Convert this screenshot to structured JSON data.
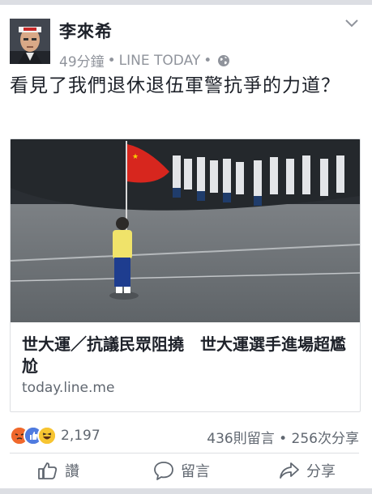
{
  "post": {
    "author": "李來希",
    "time": "49分鐘",
    "source": "LINE TODAY",
    "separator": "•",
    "privacy_icon": "globe-icon",
    "menu_icon": "chevron-down-icon",
    "text": "看見了我們退休退伍軍警抗爭的力道？"
  },
  "link": {
    "title": "世大運／抗議民眾阻撓　世大運選手進場超尷尬",
    "domain": "today.line.me"
  },
  "reactions": {
    "icons": [
      "angry-icon",
      "like-icon",
      "haha-icon"
    ],
    "count": "2,197",
    "comments": "436則留言",
    "shares": "256次分享",
    "separator": "•"
  },
  "actions": {
    "like": "讚",
    "comment": "留言",
    "share": "分享"
  },
  "colors": {
    "meta_gray": "#90949c",
    "like_blue": "#4267b2",
    "angry_orange": "#e9710f",
    "haha_yellow": "#f7b125"
  }
}
